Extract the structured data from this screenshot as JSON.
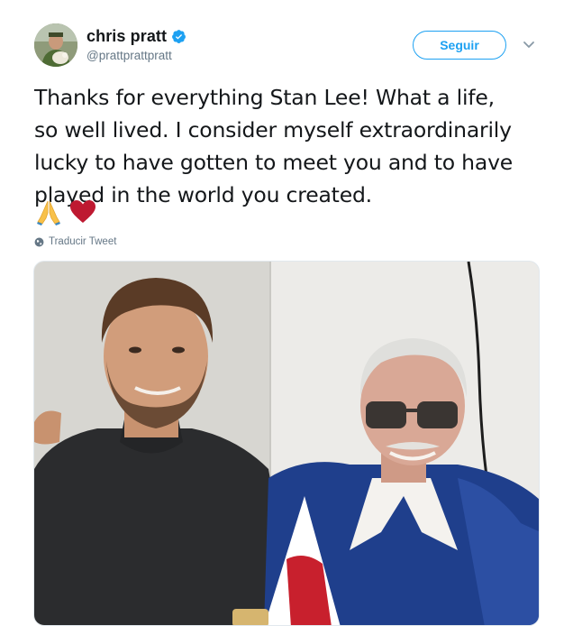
{
  "user": {
    "display_name": "chris pratt",
    "handle": "@prattprattpratt",
    "verified": true,
    "avatar_icon": "profile-photo"
  },
  "actions": {
    "follow_label": "Seguir",
    "more_icon": "chevron-down-icon"
  },
  "tweet": {
    "text": "Thanks for everything Stan Lee! What a life,\nso well lived. I consider myself extraordinarily\nlucky to have gotten to meet you and to have\nplayed in the world you created.",
    "emojis": [
      "🙏",
      "❤️"
    ]
  },
  "translate": {
    "label": "Traducir Tweet",
    "icon": "globe-icon"
  },
  "media": {
    "type": "photo"
  },
  "colors": {
    "accent": "#1da1f2",
    "text": "#14171a",
    "secondary": "#657786"
  }
}
